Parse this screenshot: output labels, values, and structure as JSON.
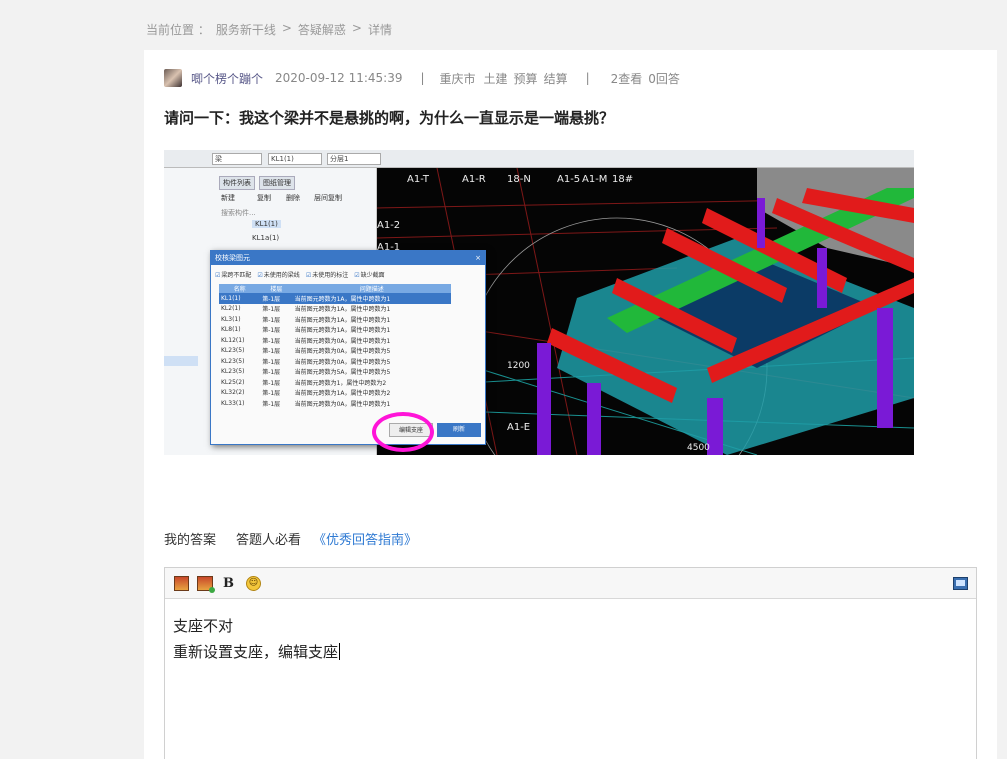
{
  "breadcrumb": {
    "label": "当前位置 ：",
    "items": [
      "服务新干线",
      "答疑解惑",
      "详情"
    ],
    "separator": ">"
  },
  "question": {
    "author": "唧个楞个蹦个",
    "date": "2020-09-12 11:45:39",
    "location": "重庆市",
    "tags": [
      "土建",
      "预算",
      "结算"
    ],
    "views": "2查看",
    "answers": "0回答",
    "divider": "|",
    "title": "请问一下：我这个梁并不是悬挑的啊，为什么一直显示是一端悬挑？"
  },
  "screenshot": {
    "topbar_fields": [
      "梁",
      "KL1(1)",
      "分层1"
    ],
    "side_tabs": [
      "构件列表",
      "图纸管理"
    ],
    "side_items": [
      "KL1(1)",
      "KL1a(1)",
      "新建",
      "复制",
      "删除",
      "层间复制",
      "搜索构件..."
    ],
    "dialog_title": "校核梁图元",
    "checks": [
      "梁跨不匹配",
      "未使用的梁线",
      "未使用的标注",
      "缺少截面"
    ],
    "columns": [
      "名称",
      "楼层",
      "问题描述"
    ],
    "rows": [
      [
        "KL1(1)",
        "第-1层",
        "当前图元跨数为1A，属性中跨数为1"
      ],
      [
        "KL2(1)",
        "第-1层",
        "当前图元跨数为1A，属性中跨数为1"
      ],
      [
        "KL3(1)",
        "第-1层",
        "当前图元跨数为1A，属性中跨数为1"
      ],
      [
        "KL8(1)",
        "第-1层",
        "当前图元跨数为1A，属性中跨数为1"
      ],
      [
        "KL12(1)",
        "第-1层",
        "当前图元跨数为0A，属性中跨数为1"
      ],
      [
        "KL23(5)",
        "第-1层",
        "当前图元跨数为0A，属性中跨数为5"
      ],
      [
        "KL23(5)",
        "第-1层",
        "当前图元跨数为0A，属性中跨数为5"
      ],
      [
        "KL23(5)",
        "第-1层",
        "当前图元跨数为5A，属性中跨数为5"
      ],
      [
        "KL25(2)",
        "第-1层",
        "当前图元跨数为1，属性中跨数为2"
      ],
      [
        "KL32(2)",
        "第-1层",
        "当前图元跨数为1A，属性中跨数为2"
      ],
      [
        "KL33(1)",
        "第-1层",
        "当前图元跨数为0A，属性中跨数为1"
      ]
    ],
    "btn_edit": "编辑支座",
    "btn_refresh": "刷新",
    "scene_labels": [
      "A1-T",
      "A1-R",
      "18-N",
      "A1-5",
      "A1-M",
      "18#",
      "A1-2",
      "A1-1",
      "1200",
      "A1-E",
      "4500"
    ]
  },
  "answer": {
    "my_answer": "我的答案",
    "must_read": "答题人必看",
    "guide": "《优秀回答指南》",
    "lines": [
      "支座不对",
      "重新设置支座，编辑支座"
    ]
  },
  "toolbar": {
    "bold": "B",
    "emoji": "☺",
    "icons": [
      "image-icon",
      "gallery-icon",
      "bold-icon",
      "emoji-icon",
      "source-icon"
    ]
  }
}
